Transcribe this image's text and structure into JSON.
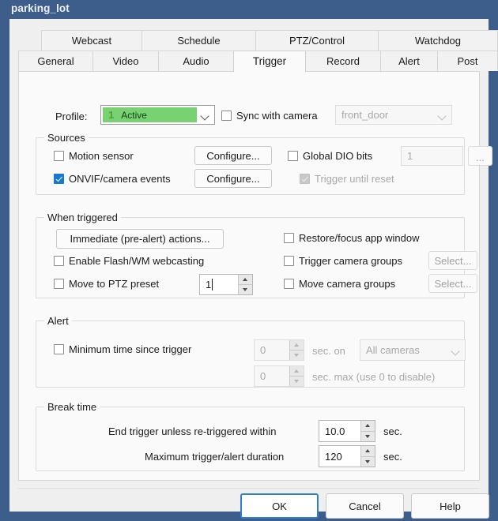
{
  "window": {
    "title": "parking_lot"
  },
  "tabs": {
    "top_row": [
      {
        "label": "Webcast",
        "active": false
      },
      {
        "label": "Schedule",
        "active": false
      },
      {
        "label": "PTZ/Control",
        "active": false
      },
      {
        "label": "Watchdog",
        "active": false
      }
    ],
    "bottom_row": [
      {
        "label": "General",
        "active": false
      },
      {
        "label": "Video",
        "active": false
      },
      {
        "label": "Audio",
        "active": false
      },
      {
        "label": "Trigger",
        "active": true
      },
      {
        "label": "Record",
        "active": false
      },
      {
        "label": "Alert",
        "active": false
      },
      {
        "label": "Post",
        "active": false
      }
    ]
  },
  "profile_row": {
    "label": "Profile:",
    "profile_number": "1",
    "profile_value": "Active",
    "sync_with_camera_label": "Sync with camera",
    "sync_with_camera_checked": false,
    "camera_value": "front_door",
    "camera_enabled": false
  },
  "sources": {
    "title": "Sources",
    "motion_sensor_label": "Motion sensor",
    "motion_sensor_checked": false,
    "motion_configure_label": "Configure...",
    "onvif_label": "ONVIF/camera events",
    "onvif_checked": true,
    "onvif_configure_label": "Configure...",
    "global_dio_label": "Global DIO bits",
    "global_dio_checked": false,
    "global_dio_value": "1",
    "global_dio_more_label": "...",
    "trigger_until_reset_label": "Trigger until reset",
    "trigger_until_reset_checked": true,
    "trigger_until_reset_enabled": false
  },
  "when_triggered": {
    "title": "When triggered",
    "immediate_actions_label": "Immediate (pre-alert) actions...",
    "enable_flash_label": "Enable Flash/WM webcasting",
    "enable_flash_checked": false,
    "move_ptz_label": "Move to PTZ preset",
    "move_ptz_checked": false,
    "move_ptz_value": "1",
    "restore_focus_label": "Restore/focus app window",
    "restore_focus_checked": false,
    "trigger_camera_groups_label": "Trigger camera groups",
    "trigger_camera_groups_checked": false,
    "trigger_camera_groups_select": "Select...",
    "move_camera_groups_label": "Move camera groups",
    "move_camera_groups_checked": false,
    "move_camera_groups_select": "Select..."
  },
  "alert": {
    "title": "Alert",
    "min_time_label": "Minimum time since trigger",
    "min_time_checked": false,
    "sec_on_value": "0",
    "sec_on_label": "sec. on",
    "cameras_value": "All cameras",
    "sec_max_value": "0",
    "sec_max_label": "sec. max (use 0 to disable)"
  },
  "break_time": {
    "title": "Break time",
    "end_trigger_label": "End trigger unless re-triggered within",
    "end_trigger_value": "10.0",
    "end_trigger_unit": "sec.",
    "max_duration_label": "Maximum trigger/alert duration",
    "max_duration_value": "120",
    "max_duration_unit": "sec."
  },
  "footer": {
    "ok_label": "OK",
    "cancel_label": "Cancel",
    "help_label": "Help"
  },
  "colors": {
    "titlebar": "#3d5d8a",
    "accent_blue": "#1878d2",
    "profile_green": "#79d271",
    "default_button_border": "#2f7fd0"
  }
}
